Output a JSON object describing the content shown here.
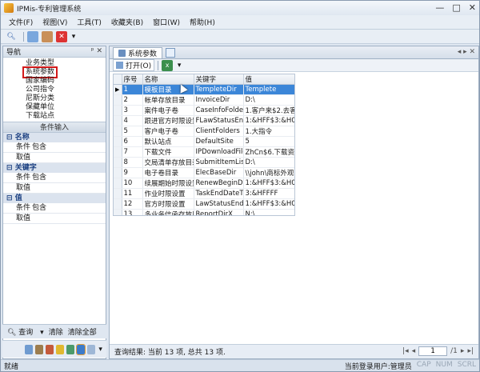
{
  "window": {
    "title": "IPMis-专利管理系统",
    "controls": [
      "—",
      "□",
      "✕"
    ]
  },
  "menu": [
    "文件(F)",
    "视图(V)",
    "工具(T)",
    "收藏夹(B)",
    "窗口(W)",
    "帮助(H)"
  ],
  "nav": {
    "title": "导航",
    "pin": "ᵖ ✕",
    "items": [
      "业务类型",
      "系统参数",
      "国家编码",
      "公司指令",
      "尼斯分类",
      "保藏单位",
      "下载站点"
    ],
    "selected_index": 1
  },
  "conditions": {
    "title": "条件输入",
    "groups": [
      {
        "title": "名称",
        "cond_label": "条件",
        "cond_value": "包含",
        "value_label": "取值"
      },
      {
        "title": "关键字",
        "cond_label": "条件",
        "cond_value": "包含",
        "value_label": "取值"
      },
      {
        "title": "值",
        "cond_label": "条件",
        "cond_value": "包含",
        "value_label": "取值"
      }
    ]
  },
  "left_actions": {
    "search": "查询",
    "clear": "清除",
    "clear_all": "清除全部"
  },
  "tab": {
    "label": "系统参数"
  },
  "subtool": {
    "open": "打开(O)"
  },
  "grid": {
    "columns": [
      "序号",
      "名称",
      "关键字",
      "值"
    ],
    "rows": [
      [
        "1",
        "模板目录",
        "TempleteDir",
        "Templete"
      ],
      [
        "2",
        "帐单存放目录",
        "InvoiceDir",
        "D:\\"
      ],
      [
        "3",
        "案件电子卷",
        "CaseInfoFolders",
        "1.客户来$2.去客户"
      ],
      [
        "4",
        "跟进官方时限设置",
        "FLawStatusEndD",
        "1:&HFF$3:&H0C8I"
      ],
      [
        "5",
        "客户电子卷",
        "ClientFolders",
        "1.大指令"
      ],
      [
        "6",
        "默认站点",
        "DefaultSite",
        "5"
      ],
      [
        "7",
        "下载文件",
        "IPDownloadFiles",
        "ZhCn$6.下载资料"
      ],
      [
        "8",
        "交局清单存放目录",
        "SubmitItemListD",
        "D:\\"
      ],
      [
        "9",
        "电子卷目录",
        "ElecBaseDir",
        "\\\\john\\商标外观改"
      ],
      [
        "10",
        "续展期始时限设置",
        "RenewBeginDate",
        "1:&HFF$3:&H0C8I"
      ],
      [
        "11",
        "作业时限设置",
        "TaskEndDateTim",
        "3:&HFFFF"
      ],
      [
        "12",
        "官方时限设置",
        "LawStatusEndDa",
        "1:&HFF$3:&H0C8I"
      ],
      [
        "13",
        "多业务信函存放目",
        "ReportDirX",
        "N:\\"
      ]
    ],
    "selected_row": 0
  },
  "result": {
    "text": "查询结果: 当前 13 项, 总共 13 项.",
    "page": "1",
    "total": "/1"
  },
  "status": {
    "left": "就绪",
    "user": "当前登录用户:管理员",
    "caps": "CAP",
    "num": "NUM",
    "scrl": "SCRL"
  }
}
